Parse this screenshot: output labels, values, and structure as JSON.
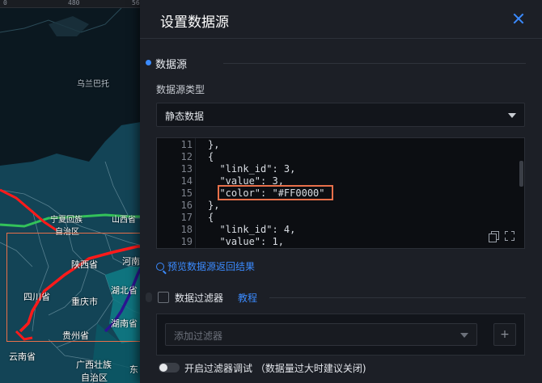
{
  "map": {
    "ruler_ticks": [
      "480",
      "56"
    ],
    "labels": {
      "wulanchabu": "乌兰巴托",
      "ningxia_1": "宁夏回族",
      "ningxia_2": "自治区",
      "shanxi": "山西省",
      "shaanxi": "陕西省",
      "henan": "河南",
      "sichuan": "四川省",
      "chongqing": "重庆市",
      "hubei": "湖北省",
      "hunan": "湖南省",
      "guizhou": "贵州省",
      "yunnan": "云南省",
      "guangxi_1": "广西壮族",
      "guangxi_2": "自治区",
      "east": "东"
    },
    "line_colors": {
      "red": "#ff1a1a",
      "green": "#33c25a",
      "purple": "#2b1591",
      "land": "#134456",
      "water": "#0f7d86"
    }
  },
  "panel": {
    "title": "设置数据源",
    "section_title": "数据源",
    "type_label": "数据源类型",
    "type_value": "静态数据",
    "editor": {
      "line_numbers": [
        "11",
        "12",
        "13",
        "14",
        "15",
        "16",
        "17",
        "18",
        "19"
      ],
      "lines": [
        "},",
        "{",
        "  \"link_id\": 3,",
        "  \"value\": 3,",
        "  \"color\": \"#FF0000\"",
        "},",
        "{",
        "  \"link_id\": 4,",
        "  \"value\": 1,"
      ]
    },
    "preview_link": "预览数据源返回结果",
    "filter_label": "数据过滤器",
    "tutorial_link": "教程",
    "filter_placeholder": "添加过滤器",
    "add_symbol": "+",
    "toggle_label": "开启过滤器调试 （数据量过大时建议关闭)",
    "accent_color": "#3b8bff",
    "highlight_color": "#e8704a"
  }
}
